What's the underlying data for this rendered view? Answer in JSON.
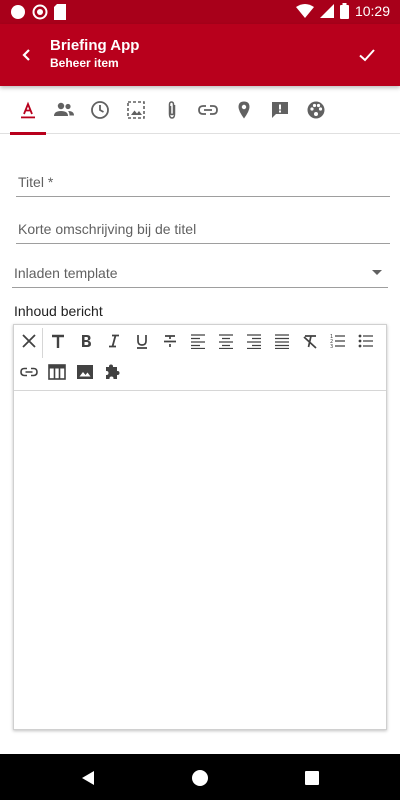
{
  "status_bar": {
    "time": "10:29",
    "icons": [
      "circle-icon",
      "circle-outline-icon",
      "sd-card-icon",
      "wifi-icon",
      "signal-icon",
      "battery-icon"
    ]
  },
  "app_bar": {
    "title": "Briefing App",
    "subtitle": "Beheer item",
    "icons": [
      "back-arrow-icon",
      "checkmark-icon"
    ]
  },
  "tabs": [
    {
      "icon": "text-format-icon",
      "active": true
    },
    {
      "icon": "people-icon"
    },
    {
      "icon": "clock-icon"
    },
    {
      "icon": "image-icon"
    },
    {
      "icon": "attachment-icon"
    },
    {
      "icon": "link-icon"
    },
    {
      "icon": "location-pin-icon"
    },
    {
      "icon": "feedback-icon"
    },
    {
      "icon": "palette-icon"
    }
  ],
  "form": {
    "title_placeholder": "Titel *",
    "short_desc_placeholder": "Korte omschrijving bij de titel",
    "template_select": "Inladen template",
    "content_label": "Inhoud bericht"
  },
  "editor_toolbar": {
    "row1": [
      "close-icon",
      "text-size-icon",
      "bold-icon",
      "italic-icon",
      "underline-icon",
      "strikethrough-icon",
      "align-left-icon",
      "align-center-icon",
      "align-right-icon",
      "align-justify-icon",
      "clear-format-icon",
      "ordered-list-icon",
      "unordered-list-icon"
    ],
    "row2": [
      "link-icon",
      "table-icon",
      "image-icon",
      "extension-icon"
    ]
  },
  "colors": {
    "primary": "#b8001c",
    "status_bar": "#a8001a",
    "nav_bar": "#000000"
  }
}
